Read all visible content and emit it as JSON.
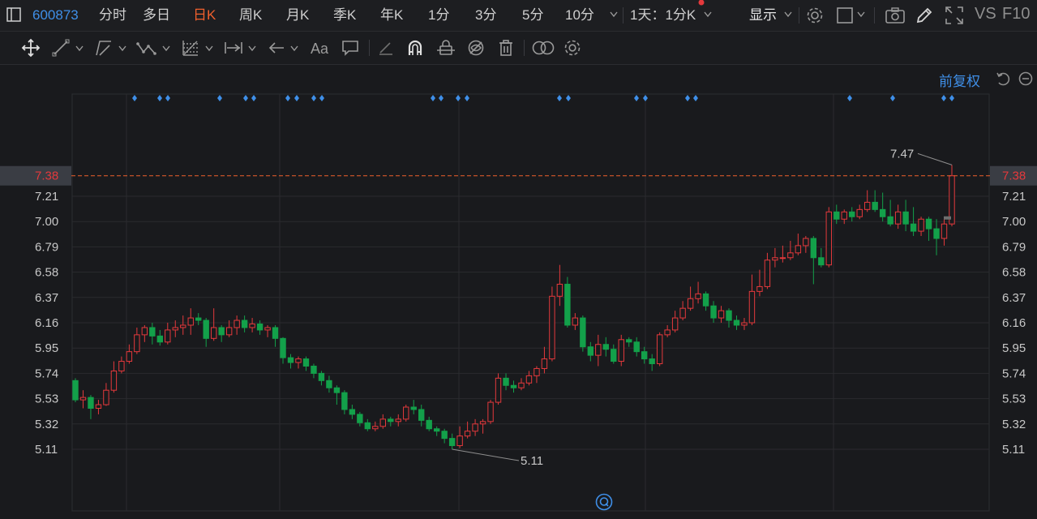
{
  "top": {
    "code": "600873",
    "periods": [
      "分时",
      "多日",
      "日K",
      "周K",
      "月K",
      "季K",
      "年K",
      "1分",
      "3分",
      "5分",
      "10分"
    ],
    "active_period": "日K",
    "range_select": "1天：1分K",
    "display_label": "显示",
    "vs_label": "VS",
    "f10_label": "F10"
  },
  "toolbar": {
    "icons": [
      "move-icon",
      "line-draw-icon",
      "channel-icon",
      "wave-icon",
      "fib-icon",
      "measure-icon",
      "arrow-icon",
      "text-icon",
      "comment-icon",
      "eraser-icon",
      "magnet-icon",
      "lock-icon",
      "hide-icon",
      "delete-icon",
      "overlay-icon",
      "settings-icon"
    ]
  },
  "chart": {
    "adjust_label": "前复权",
    "y_ticks": [
      "7.21",
      "7.00",
      "6.79",
      "6.58",
      "6.37",
      "6.16",
      "5.95",
      "5.74",
      "5.53",
      "5.32",
      "5.11"
    ],
    "current_price": "7.38",
    "high_label": "7.47",
    "low_label": "5.11",
    "colors": {
      "up": "#e4393c",
      "down": "#13a04a",
      "price_line": "#f0602d",
      "marker": "#3f8fe8"
    }
  },
  "chart_data": {
    "type": "candlestick",
    "ylim": [
      5.0,
      7.6
    ],
    "y_ticks": [
      7.21,
      7.0,
      6.79,
      6.58,
      6.37,
      6.16,
      5.95,
      5.74,
      5.53,
      5.32,
      5.11
    ],
    "current_price": 7.38,
    "high": 7.47,
    "low": 5.11,
    "candles": [
      [
        5.68,
        5.52,
        5.7,
        5.5
      ],
      [
        5.52,
        5.54,
        5.6,
        5.45
      ],
      [
        5.54,
        5.45,
        5.56,
        5.36
      ],
      [
        5.45,
        5.48,
        5.52,
        5.4
      ],
      [
        5.48,
        5.6,
        5.66,
        5.47
      ],
      [
        5.6,
        5.76,
        5.84,
        5.58
      ],
      [
        5.76,
        5.84,
        5.88,
        5.74
      ],
      [
        5.84,
        5.92,
        5.98,
        5.82
      ],
      [
        5.92,
        6.06,
        6.12,
        5.9
      ],
      [
        6.06,
        6.12,
        6.14,
        6.0
      ],
      [
        6.12,
        6.05,
        6.16,
        5.98
      ],
      [
        6.05,
        6.0,
        6.1,
        5.97
      ],
      [
        6.0,
        6.1,
        6.16,
        5.98
      ],
      [
        6.1,
        6.12,
        6.18,
        6.04
      ],
      [
        6.12,
        6.14,
        6.22,
        6.06
      ],
      [
        6.14,
        6.2,
        6.28,
        6.06
      ],
      [
        6.2,
        6.18,
        6.24,
        6.14
      ],
      [
        6.18,
        6.03,
        6.2,
        5.96
      ],
      [
        6.03,
        6.12,
        6.28,
        6.01
      ],
      [
        6.12,
        6.06,
        6.14,
        6.0
      ],
      [
        6.06,
        6.12,
        6.18,
        6.04
      ],
      [
        6.12,
        6.18,
        6.22,
        6.06
      ],
      [
        6.18,
        6.12,
        6.22,
        6.08
      ],
      [
        6.12,
        6.15,
        6.2,
        6.08
      ],
      [
        6.15,
        6.1,
        6.18,
        6.06
      ],
      [
        6.1,
        6.12,
        6.14,
        6.04
      ],
      [
        6.12,
        6.03,
        6.14,
        5.96
      ],
      [
        6.03,
        5.87,
        6.04,
        5.82
      ],
      [
        5.87,
        5.83,
        5.9,
        5.78
      ],
      [
        5.83,
        5.86,
        5.88,
        5.78
      ],
      [
        5.86,
        5.8,
        5.88,
        5.76
      ],
      [
        5.8,
        5.74,
        5.82,
        5.7
      ],
      [
        5.74,
        5.68,
        5.76,
        5.64
      ],
      [
        5.68,
        5.62,
        5.72,
        5.58
      ],
      [
        5.62,
        5.58,
        5.64,
        5.48
      ],
      [
        5.58,
        5.44,
        5.6,
        5.4
      ],
      [
        5.44,
        5.4,
        5.48,
        5.36
      ],
      [
        5.4,
        5.33,
        5.42,
        5.3
      ],
      [
        5.33,
        5.28,
        5.36,
        5.26
      ],
      [
        5.28,
        5.3,
        5.34,
        5.26
      ],
      [
        5.3,
        5.36,
        5.4,
        5.28
      ],
      [
        5.36,
        5.34,
        5.38,
        5.3
      ],
      [
        5.34,
        5.36,
        5.4,
        5.3
      ],
      [
        5.36,
        5.46,
        5.48,
        5.34
      ],
      [
        5.46,
        5.44,
        5.52,
        5.4
      ],
      [
        5.44,
        5.35,
        5.48,
        5.3
      ],
      [
        5.35,
        5.28,
        5.38,
        5.26
      ],
      [
        5.28,
        5.26,
        5.3,
        5.22
      ],
      [
        5.26,
        5.2,
        5.28,
        5.16
      ],
      [
        5.2,
        5.14,
        5.24,
        5.11
      ],
      [
        5.14,
        5.22,
        5.3,
        5.12
      ],
      [
        5.22,
        5.26,
        5.34,
        5.2
      ],
      [
        5.26,
        5.32,
        5.36,
        5.22
      ],
      [
        5.32,
        5.34,
        5.36,
        5.24
      ],
      [
        5.34,
        5.5,
        5.52,
        5.32
      ],
      [
        5.5,
        5.7,
        5.74,
        5.48
      ],
      [
        5.7,
        5.64,
        5.74,
        5.6
      ],
      [
        5.64,
        5.62,
        5.68,
        5.58
      ],
      [
        5.62,
        5.66,
        5.7,
        5.6
      ],
      [
        5.66,
        5.72,
        5.76,
        5.64
      ],
      [
        5.72,
        5.78,
        5.8,
        5.66
      ],
      [
        5.78,
        5.86,
        5.96,
        5.74
      ],
      [
        5.86,
        6.38,
        6.46,
        5.84
      ],
      [
        6.38,
        6.48,
        6.64,
        6.3
      ],
      [
        6.48,
        6.14,
        6.54,
        6.12
      ],
      [
        6.14,
        6.2,
        6.24,
        6.1
      ],
      [
        6.2,
        5.96,
        6.22,
        5.92
      ],
      [
        5.96,
        5.89,
        6.0,
        5.84
      ],
      [
        5.89,
        5.98,
        6.06,
        5.8
      ],
      [
        5.98,
        5.94,
        6.04,
        5.88
      ],
      [
        5.94,
        5.84,
        5.98,
        5.82
      ],
      [
        5.84,
        6.02,
        6.06,
        5.8
      ],
      [
        6.02,
        6.0,
        6.04,
        5.96
      ],
      [
        6.0,
        5.92,
        6.04,
        5.88
      ],
      [
        5.92,
        5.86,
        5.96,
        5.82
      ],
      [
        5.86,
        5.82,
        5.9,
        5.76
      ],
      [
        5.82,
        6.06,
        6.08,
        5.8
      ],
      [
        6.06,
        6.1,
        6.14,
        6.04
      ],
      [
        6.1,
        6.2,
        6.26,
        6.08
      ],
      [
        6.2,
        6.28,
        6.34,
        6.18
      ],
      [
        6.28,
        6.36,
        6.46,
        6.26
      ],
      [
        6.36,
        6.4,
        6.5,
        6.32
      ],
      [
        6.4,
        6.3,
        6.42,
        6.26
      ],
      [
        6.3,
        6.2,
        6.34,
        6.16
      ],
      [
        6.2,
        6.26,
        6.3,
        6.16
      ],
      [
        6.26,
        6.18,
        6.28,
        6.12
      ],
      [
        6.18,
        6.14,
        6.22,
        6.1
      ],
      [
        6.14,
        6.16,
        6.2,
        6.1
      ],
      [
        6.16,
        6.42,
        6.56,
        6.14
      ],
      [
        6.42,
        6.46,
        6.6,
        6.38
      ],
      [
        6.46,
        6.68,
        6.74,
        6.44
      ],
      [
        6.68,
        6.7,
        6.78,
        6.62
      ],
      [
        6.7,
        6.7,
        6.8,
        6.66
      ],
      [
        6.7,
        6.74,
        6.84,
        6.68
      ],
      [
        6.74,
        6.8,
        6.9,
        6.72
      ],
      [
        6.8,
        6.86,
        6.88,
        6.74
      ],
      [
        6.86,
        6.7,
        6.88,
        6.48
      ],
      [
        6.7,
        6.64,
        6.78,
        6.62
      ],
      [
        6.64,
        7.08,
        7.12,
        6.62
      ],
      [
        7.08,
        7.02,
        7.14,
        6.98
      ],
      [
        7.02,
        7.08,
        7.1,
        6.98
      ],
      [
        7.08,
        7.04,
        7.12,
        7.0
      ],
      [
        7.04,
        7.1,
        7.14,
        7.02
      ],
      [
        7.1,
        7.16,
        7.26,
        7.08
      ],
      [
        7.16,
        7.1,
        7.26,
        7.08
      ],
      [
        7.1,
        7.04,
        7.24,
        7.0
      ],
      [
        7.04,
        6.98,
        7.18,
        6.96
      ],
      [
        6.98,
        7.08,
        7.14,
        6.94
      ],
      [
        7.08,
        6.98,
        7.18,
        6.92
      ],
      [
        6.98,
        6.92,
        7.12,
        6.88
      ],
      [
        6.92,
        7.02,
        7.04,
        6.88
      ],
      [
        7.02,
        6.94,
        7.04,
        6.84
      ],
      [
        6.94,
        6.86,
        7.02,
        6.72
      ],
      [
        6.86,
        6.98,
        7.02,
        6.8
      ],
      [
        6.98,
        7.38,
        7.47,
        6.96
      ]
    ]
  }
}
